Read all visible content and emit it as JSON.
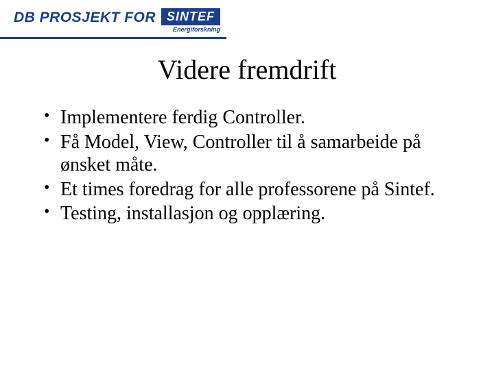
{
  "header": {
    "logo_left": "DB PROSJEKT FOR",
    "logo_right": "SINTEF",
    "logo_sub": "Energiforskning"
  },
  "title": "Videre fremdrift",
  "bullets": [
    "Implementere ferdig Controller.",
    "Få Model, View, Controller til å samarbeide på ønsket måte.",
    "Et times foredrag for alle professorene på Sintef.",
    "Testing, installasjon og opplæring."
  ]
}
